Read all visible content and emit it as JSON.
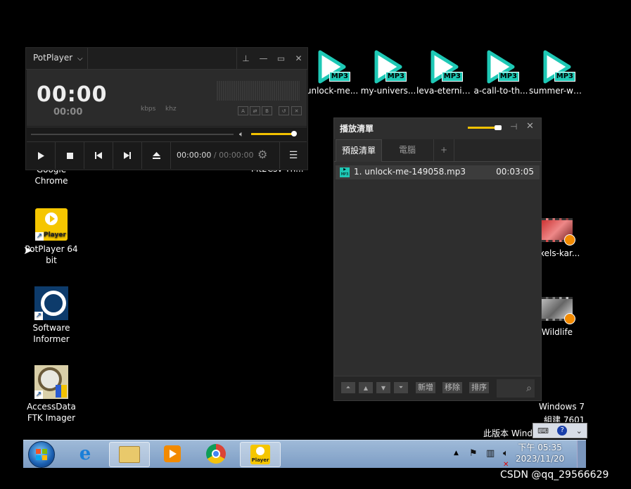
{
  "player": {
    "app_name": "PotPlayer",
    "dropdown_glyph": "⌵",
    "pin_glyph": "⊥",
    "min_glyph": "—",
    "max_glyph": "▭",
    "close_glyph": "✕",
    "time_big": "00:00",
    "time_small": "00:00",
    "kbps": "kbps",
    "khz": "khz",
    "mini_a": "A",
    "mini_repeat": "⇄",
    "mini_b": "B",
    "mini_loop": "↺",
    "mini_shuffle": "✕",
    "volume_level": 0.85,
    "timecode_current": "00:00:00",
    "timecode_sep": " / ",
    "timecode_total": "00:00:00"
  },
  "desktop_icons": [
    {
      "label": "Google Chrome",
      "line1": "Google",
      "line2": "Chrome"
    },
    {
      "label": "PotPlayer 64 bit",
      "line1": "PotPlayer 64",
      "line2": "bit"
    },
    {
      "label": "Software Informer",
      "line1": "Software",
      "line2": "Informer"
    },
    {
      "label": "AccessData FTK Imager",
      "line1": "AccessData",
      "line2": "FTK Imager"
    }
  ],
  "partial_label": "Mt2Csv Th...",
  "mp3_files": [
    {
      "label": "unlock-me...",
      "badge": "MP3"
    },
    {
      "label": "my-univers...",
      "badge": "MP3"
    },
    {
      "label": "leva-eternit...",
      "badge": "MP3"
    },
    {
      "label": "a-call-to-th...",
      "badge": "MP3"
    },
    {
      "label": "summer-wa...",
      "badge": "MP3"
    }
  ],
  "right_icons": [
    {
      "label": "exels-kar..."
    },
    {
      "label": "Wildlife"
    }
  ],
  "playlist": {
    "title": "播放清單",
    "tab_default": "預設清單",
    "tab_computer": "電腦",
    "tab_add": "+",
    "items": [
      {
        "name": "1. unlock-me-149058.mp3",
        "duration": "00:03:05",
        "icon_text": "MP3"
      }
    ],
    "btn_add": "新增",
    "btn_remove": "移除",
    "btn_sort": "排序"
  },
  "watermark": {
    "line1": "Windows 7",
    "line2": "組建 7601",
    "line3": "此版本 Wind"
  },
  "taskbar": {
    "time": "下午 05:35",
    "date": "2023/11/20",
    "potplayer_label": "Player"
  },
  "csdn": "CSDN @qq_29566629"
}
